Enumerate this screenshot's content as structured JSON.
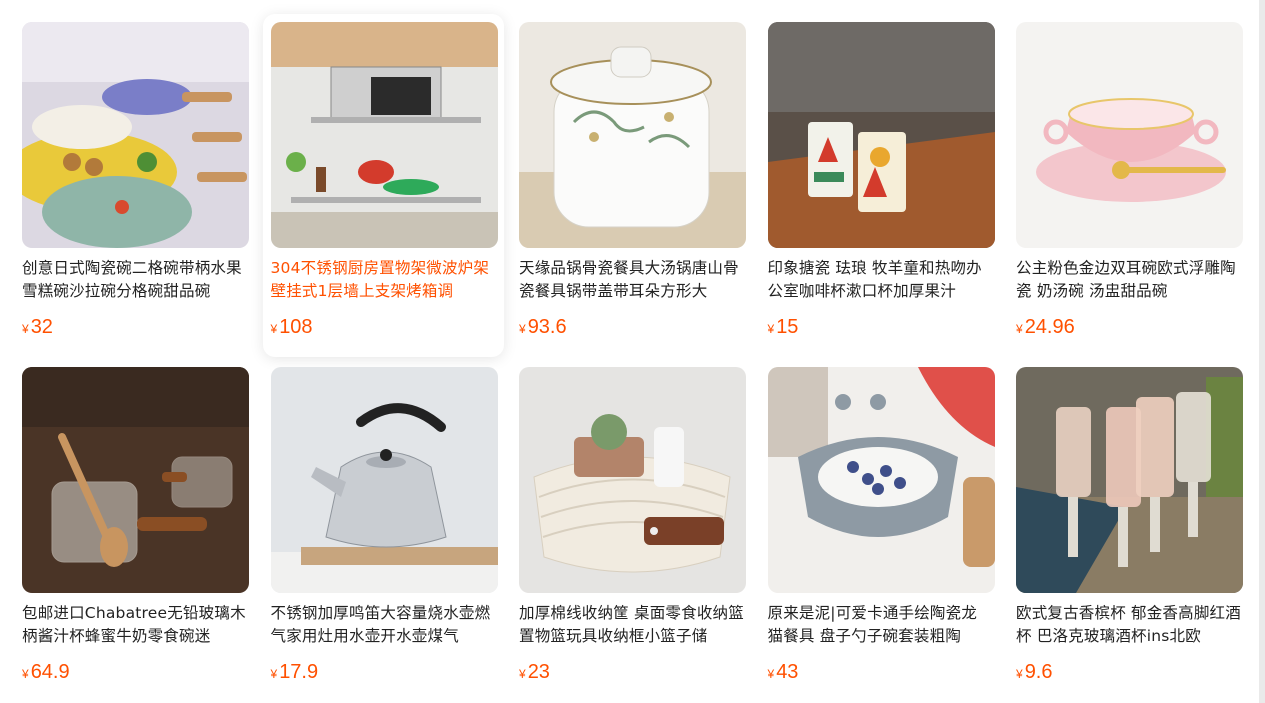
{
  "currency_symbol": "¥",
  "accent_color": "#ff5000",
  "products": [
    {
      "title": "创意日式陶瓷碗二格碗带柄水果雪糕碗沙拉碗分格碗甜品碗",
      "price": "32",
      "image": "ceramic-divided-bowls-image"
    },
    {
      "title": "304不锈钢厨房置物架微波炉架壁挂式1层墙上支架烤箱调",
      "price": "108",
      "image": "kitchen-wall-shelf-image"
    },
    {
      "title": "天缘品锅骨瓷餐具大汤锅唐山骨瓷餐具锅带盖带耳朵方形大",
      "price": "93.6",
      "image": "bone-china-soup-pot-image"
    },
    {
      "title": "印象搪瓷 珐琅 牧羊童和热吻办公室咖啡杯漱口杯加厚果汁",
      "price": "15",
      "image": "enamel-cups-image"
    },
    {
      "title": "公主粉色金边双耳碗欧式浮雕陶瓷 奶汤碗 汤盅甜品碗",
      "price": "24.96",
      "image": "pink-soup-bowl-image"
    },
    {
      "title": "包邮进口Chabatree无铅玻璃木柄酱汁杯蜂蜜牛奶零食碗迷",
      "price": "64.9",
      "image": "glass-sauce-cups-image"
    },
    {
      "title": "不锈钢加厚鸣笛大容量烧水壶燃气家用灶用水壶开水壶煤气",
      "price": "17.9",
      "image": "steel-kettle-image"
    },
    {
      "title": "加厚棉线收纳筐 桌面零食收纳篮 置物篮玩具收纳框小篮子储",
      "price": "23",
      "image": "cotton-storage-basket-image"
    },
    {
      "title": "原来是泥|可爱卡通手绘陶瓷龙猫餐具 盘子勺子碗套装粗陶",
      "price": "43",
      "image": "totoro-ceramic-bowl-image"
    },
    {
      "title": "欧式复古香槟杯 郁金香高脚红酒杯 巴洛克玻璃酒杯ins北欧",
      "price": "9.6",
      "image": "vintage-champagne-glasses-image"
    }
  ]
}
